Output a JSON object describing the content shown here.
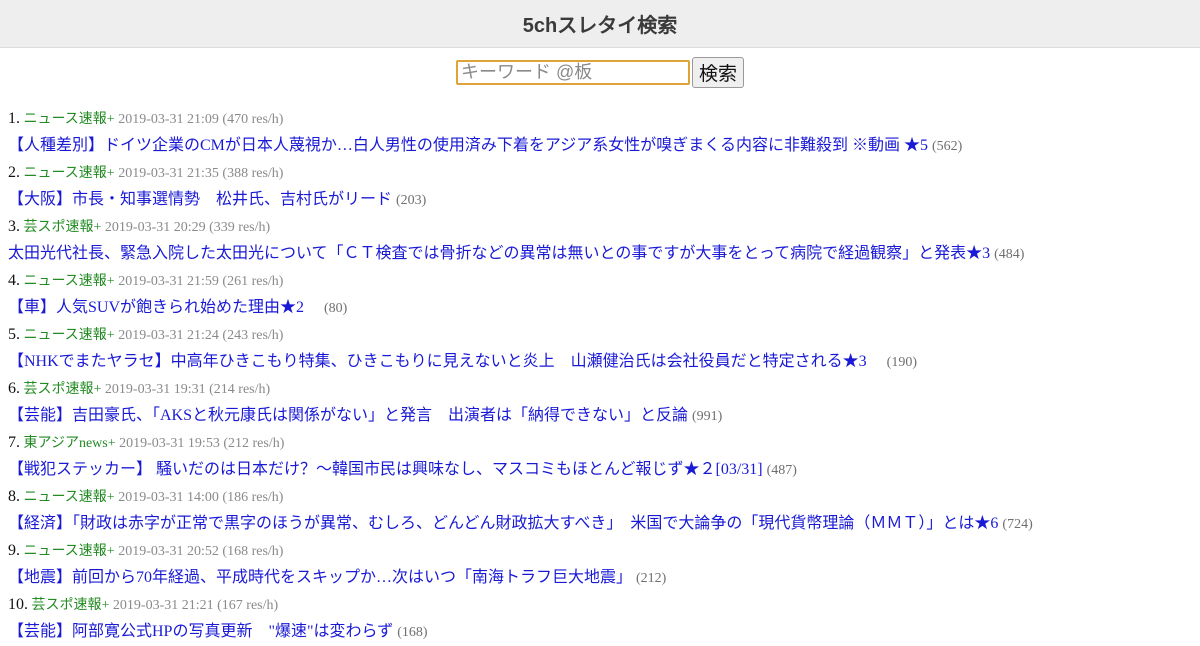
{
  "header": {
    "title": "5chスレタイ検索"
  },
  "search": {
    "placeholder": "キーワード @板",
    "value": "",
    "button_label": "検索"
  },
  "results": [
    {
      "rank": "1.",
      "board": "ニュース速報+",
      "meta": "2019-03-31 21:09 (470 res/h)",
      "title": "【人種差別】ドイツ企業のCMが日本人蔑視か…白人男性の使用済み下着をアジア系女性が嗅ぎまくる内容に非難殺到 ※動画 ★5",
      "count": "(562)"
    },
    {
      "rank": "2.",
      "board": "ニュース速報+",
      "meta": "2019-03-31 21:35 (388 res/h)",
      "title": "【大阪】市長・知事選情勢　松井氏、吉村氏がリード",
      "count": "(203)"
    },
    {
      "rank": "3.",
      "board": "芸スポ速報+",
      "meta": "2019-03-31 20:29 (339 res/h)",
      "title": "太田光代社長、緊急入院した太田光について「ＣＴ検査では骨折などの異常は無いとの事ですが大事をとって病院で経過観察」と発表★3",
      "count": "(484)"
    },
    {
      "rank": "4.",
      "board": "ニュース速報+",
      "meta": "2019-03-31 21:59 (261 res/h)",
      "title": "【車】人気SUVが飽きられ始めた理由★2　",
      "count": "(80)"
    },
    {
      "rank": "5.",
      "board": "ニュース速報+",
      "meta": "2019-03-31 21:24 (243 res/h)",
      "title": "【NHKでまたヤラセ】中高年ひきこもり特集、ひきこもりに見えないと炎上　山瀬健治氏は会社役員だと特定される★3　",
      "count": "(190)"
    },
    {
      "rank": "6.",
      "board": "芸スポ速報+",
      "meta": "2019-03-31 19:31 (214 res/h)",
      "title": "【芸能】吉田豪氏、「AKSと秋元康氏は関係がない」と発言　出演者は「納得できない」と反論",
      "count": "(991)"
    },
    {
      "rank": "7.",
      "board": "東アジアnews+",
      "meta": "2019-03-31 19:53 (212 res/h)",
      "title": "【戦犯ステッカー】 騒いだのは日本だけ？～韓国市民は興味なし、マスコミもほとんど報じず★２[03/31]",
      "count": "(487)"
    },
    {
      "rank": "8.",
      "board": "ニュース速報+",
      "meta": "2019-03-31 14:00 (186 res/h)",
      "title": "【経済】「財政は赤字が正常で黒字のほうが異常、むしろ、どんどん財政拡大すべき」　米国で大論争の「現代貨幣理論（ＭＭＴ）」とは★6",
      "count": "(724)"
    },
    {
      "rank": "9.",
      "board": "ニュース速報+",
      "meta": "2019-03-31 20:52 (168 res/h)",
      "title": "【地震】前回から70年経過、平成時代をスキップか…次はいつ「南海トラフ巨大地震」",
      "count": "(212)"
    },
    {
      "rank": "10.",
      "board": "芸スポ速報+",
      "meta": "2019-03-31 21:21 (167 res/h)",
      "title": "【芸能】阿部寛公式HPの写真更新　\"爆速\"は変わらず",
      "count": "(168)"
    }
  ]
}
